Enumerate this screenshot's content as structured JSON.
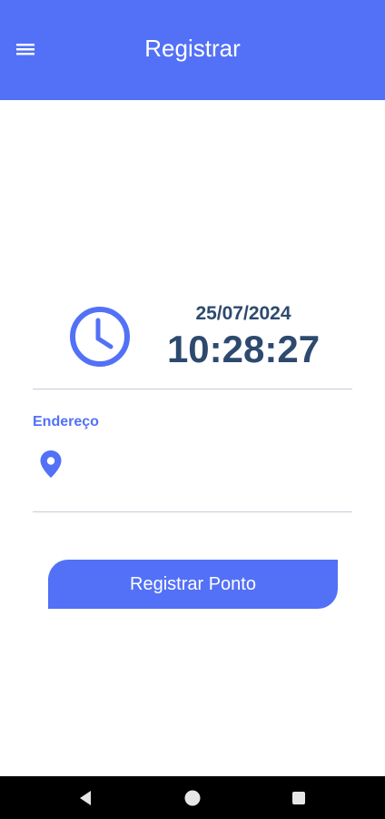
{
  "appbar": {
    "title": "Registrar",
    "menu_icon": "hamburger-menu-icon",
    "background": "#5371f6"
  },
  "clock": {
    "icon": "clock-icon",
    "date": "25/07/2024",
    "time": "10:28:27",
    "text_color": "#2d4a6e"
  },
  "address": {
    "label": "Endereço",
    "icon": "location-pin-icon",
    "value": ""
  },
  "actions": {
    "register_label": "Registrar Ponto"
  },
  "system_nav": {
    "back_icon": "back-triangle-icon",
    "home_icon": "home-circle-icon",
    "recents_icon": "recents-square-icon"
  },
  "colors": {
    "accent": "#5371f6",
    "divider": "#c6cdd9",
    "nav_bar": "#000000"
  }
}
